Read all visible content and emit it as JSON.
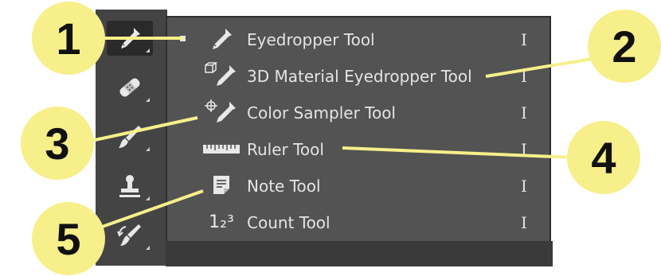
{
  "toolbar": {
    "tools": [
      {
        "icon": "eyedropper-icon",
        "active": true
      },
      {
        "icon": "bandage-icon",
        "active": false
      },
      {
        "icon": "brush-icon",
        "active": false
      },
      {
        "icon": "stamp-icon",
        "active": false
      },
      {
        "icon": "history-brush-icon",
        "active": false
      }
    ]
  },
  "flyout": {
    "items": [
      {
        "label": "Eyedropper Tool",
        "shortcut": "I",
        "icon": "eyedropper-icon",
        "selected": true
      },
      {
        "label": "3D Material Eyedropper Tool",
        "shortcut": "I",
        "icon": "3d-material-eyedropper-icon",
        "selected": false
      },
      {
        "label": "Color Sampler Tool",
        "shortcut": "I",
        "icon": "color-sampler-icon",
        "selected": false
      },
      {
        "label": "Ruler Tool",
        "shortcut": "I",
        "icon": "ruler-icon",
        "selected": false
      },
      {
        "label": "Note Tool",
        "shortcut": "I",
        "icon": "note-icon",
        "selected": false
      },
      {
        "label": "Count Tool",
        "shortcut": "I",
        "icon": "count-icon",
        "count_glyph": "1₂³",
        "selected": false
      }
    ]
  },
  "callouts": [
    "1",
    "2",
    "3",
    "4",
    "5"
  ],
  "colors": {
    "panel": "#535353",
    "toolbar": "#444444",
    "callout": "#f7ef8a",
    "text": "#e4e4e4"
  }
}
